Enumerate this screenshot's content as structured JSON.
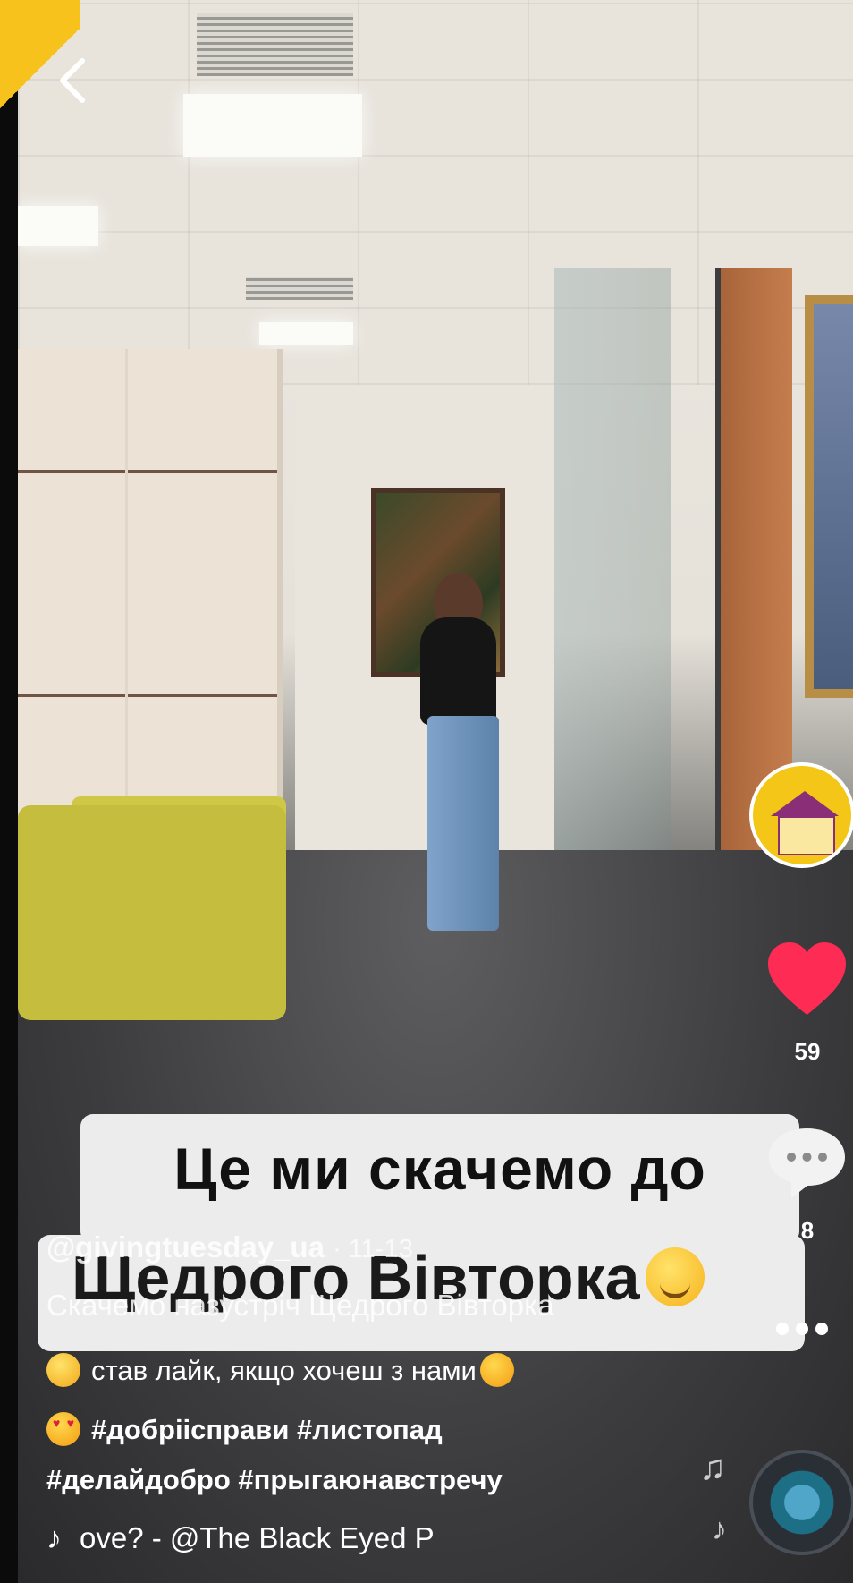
{
  "video": {
    "caption_line1": "Це ми скачемо до",
    "caption_line2": "Щедрого Вівторка"
  },
  "post": {
    "username": "@givingtuesday_ua",
    "date": "· 11-13",
    "description_line1": "Скачемо назустріч Щедрого Вівторка",
    "description_line2": "став лайк, якщо хочеш з нами",
    "hashtags_line1": "#добріісправи #листопад",
    "hashtags_line2": "#делайдобро  #прыгаюнавстречу"
  },
  "music": {
    "note_icon": "♪",
    "title": "ove? - @The Black Eyed P"
  },
  "actions": {
    "likes": "59",
    "comments": "8"
  },
  "colors": {
    "like_red": "#fe2c55",
    "accent_yellow": "#f3c617"
  },
  "icons": {
    "back": "chevron-left-icon",
    "like": "heart-icon",
    "comment": "comment-bubble-icon",
    "more": "more-dots-icon",
    "music": "music-disc-icon"
  }
}
